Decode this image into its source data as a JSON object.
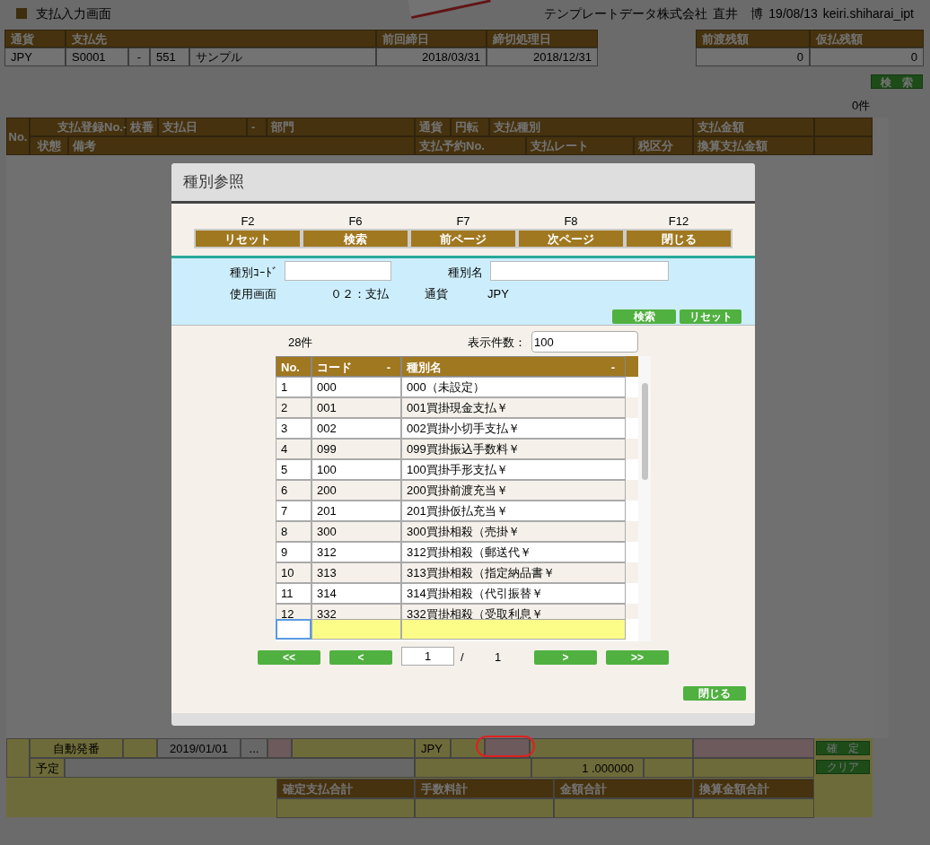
{
  "page": {
    "title": "支払入力画面",
    "company": "テンプレートデータ株式会社",
    "user": "直井　博",
    "date": "19/08/13",
    "program": "keiri.shiharai_ipt"
  },
  "header_table": {
    "columns": [
      "通貨",
      "支払先",
      "前回締日",
      "締切処理日"
    ],
    "row": [
      "JPY",
      "S0001",
      "-",
      "551",
      "サンプル",
      "2018/03/31",
      "2018/12/31"
    ]
  },
  "balance_table": {
    "columns": [
      "前渡残額",
      "仮払残額"
    ],
    "row": [
      "0",
      "0"
    ]
  },
  "search_button": "検　索",
  "result_count": "0件",
  "list_header": {
    "no": "No.",
    "row_1": [
      "支払登録No.-",
      "枝番",
      "支払日",
      "-",
      "部門",
      "通貨",
      "円転",
      "支払種別",
      "支払金額"
    ],
    "row_2": [
      "状態",
      "備考",
      "支払予約No.",
      "支払レート",
      "税区分",
      "換算支払金額"
    ]
  },
  "bottom_form": {
    "numbering": "自動発番",
    "date": "2019/01/01",
    "date_button": "...",
    "currency": "JPY",
    "plan_label": "予定",
    "rate": "1 .000000",
    "confirm_button": "確　定",
    "clear_button": "クリア",
    "totals": [
      "確定支払合計",
      "手数料計",
      "金額合計",
      "換算金額合計"
    ]
  },
  "dialog": {
    "title": "種別参照",
    "function_keys": [
      {
        "key": "F2",
        "label": "リセット"
      },
      {
        "key": "F6",
        "label": "検索"
      },
      {
        "key": "F7",
        "label": "前ページ"
      },
      {
        "key": "F8",
        "label": "次ページ"
      },
      {
        "key": "F12",
        "label": "閉じる"
      }
    ],
    "filters": {
      "code_label": "種別ｺｰﾄﾞ",
      "name_label": "種別名",
      "screen_label": "使用画面",
      "screen_value": "０２：支払",
      "currency_label": "通貨",
      "currency_value": "JPY",
      "search_button": "検索",
      "reset_button": "リセット"
    },
    "count": "28件",
    "page_size_label": "表示件数：",
    "page_size": "100",
    "table": {
      "columns": [
        "No.",
        "コード",
        "種別名"
      ],
      "sort_marks": [
        "-",
        "-"
      ],
      "rows": [
        [
          "1",
          "000",
          "000（未設定）"
        ],
        [
          "2",
          "001",
          "001買掛現金支払￥"
        ],
        [
          "3",
          "002",
          "002買掛小切手支払￥"
        ],
        [
          "4",
          "099",
          "099買掛振込手数料￥"
        ],
        [
          "5",
          "100",
          "100買掛手形支払￥"
        ],
        [
          "6",
          "200",
          "200買掛前渡充当￥"
        ],
        [
          "7",
          "201",
          "201買掛仮払充当￥"
        ],
        [
          "8",
          "300",
          "300買掛相殺（売掛￥"
        ],
        [
          "9",
          "312",
          "312買掛相殺（郵送代￥"
        ],
        [
          "10",
          "313",
          "313買掛相殺（指定納品書￥"
        ],
        [
          "11",
          "314",
          "314買掛相殺（代引振替￥"
        ],
        [
          "12",
          "332",
          "332買掛相殺（受取利息￥"
        ]
      ]
    },
    "pager": {
      "first": "<<",
      "prev": "<",
      "page": "1",
      "separator": "/",
      "total": "1",
      "next": ">",
      "last": ">>"
    },
    "close_button": "閉じる"
  }
}
